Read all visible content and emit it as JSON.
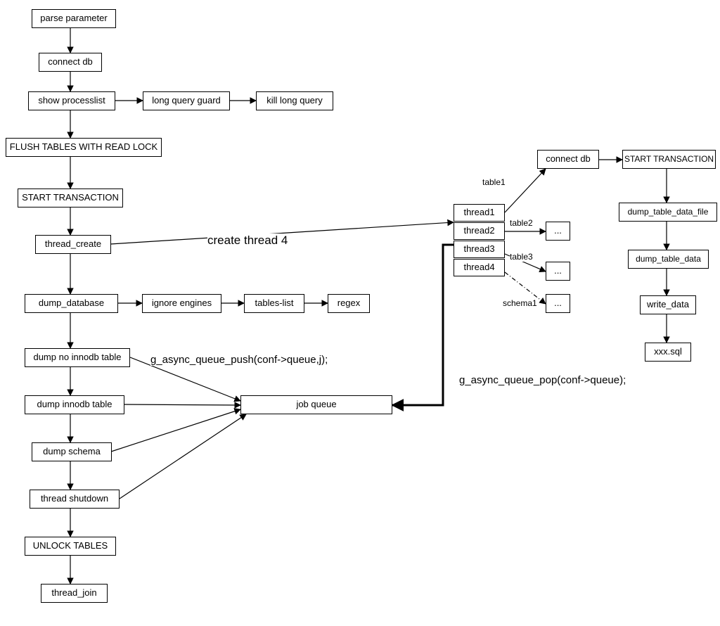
{
  "nodes": {
    "parse_parameter": "parse parameter",
    "connect_db1": "connect db",
    "show_processlist": "show processlist",
    "long_query_guard": "long query guard",
    "kill_long_query": "kill long query",
    "flush_tables": "FLUSH TABLES WITH READ LOCK",
    "start_transaction1": "START TRANSACTION",
    "thread_create": "thread_create",
    "dump_database": "dump_database",
    "ignore_engines": "ignore engines",
    "tables_list": "tables-list",
    "regex": "regex",
    "dump_no_innodb": "dump no innodb table",
    "dump_innodb": "dump innodb table",
    "dump_schema": "dump schema",
    "thread_shutdown": "thread shutdown",
    "unlock_tables": "UNLOCK TABLES",
    "thread_join": "thread_join",
    "job_queue": "job queue",
    "thread1": "thread1",
    "thread2": "thread2",
    "thread3": "thread3",
    "thread4": "thread4",
    "dots2": "...",
    "dots3": "...",
    "dots4": "...",
    "connect_db2": "connect db",
    "start_transaction2": "START TRANSACTION",
    "dump_table_data_file": "dump_table_data_file",
    "dump_table_data": "dump_table_data",
    "write_data": "write_data",
    "xxx_sql": "xxx.sql"
  },
  "labels": {
    "create_thread_4": "create thread 4",
    "g_async_push": "g_async_queue_push(conf->queue,j);",
    "g_async_pop": "g_async_queue_pop(conf->queue);",
    "table1": "table1",
    "table2": "table2",
    "table3": "table3",
    "schema1": "schema1"
  }
}
